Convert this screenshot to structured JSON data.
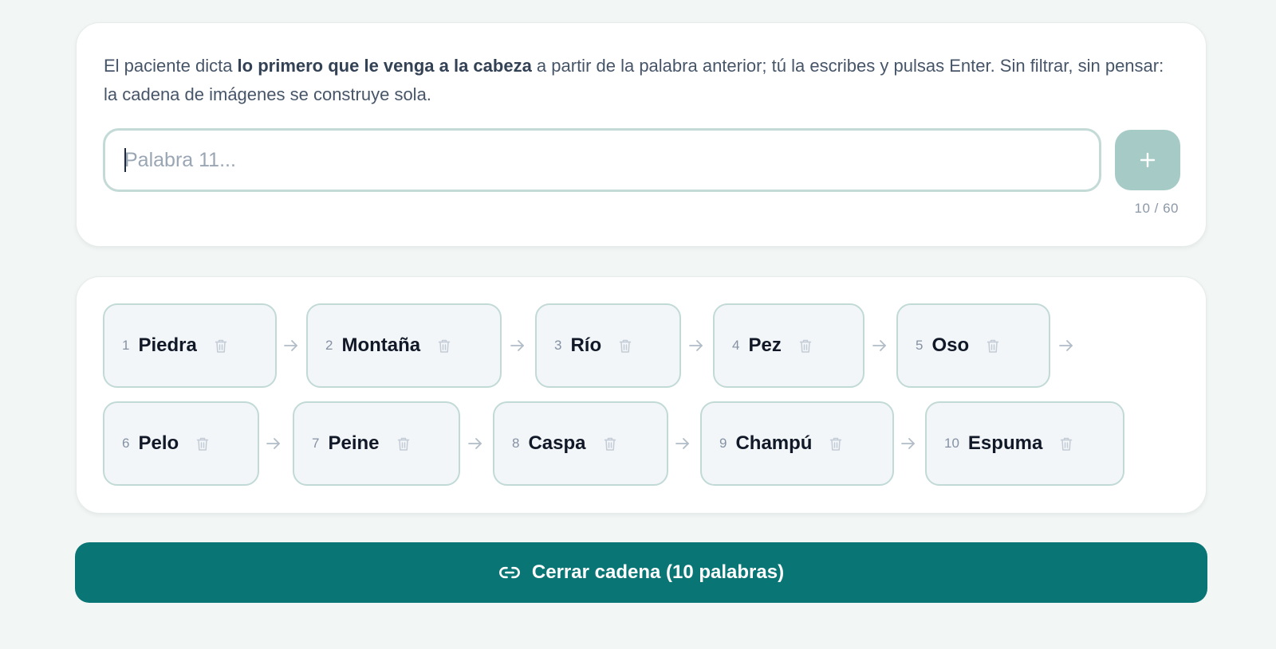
{
  "instructions": {
    "before": "El paciente dicta ",
    "bold": "lo primero que le venga a la cabeza",
    "after": " a partir de la palabra anterior; tú la escribes y pulsas Enter. Sin filtrar, sin pensar: la cadena de imágenes se construye sola."
  },
  "input": {
    "placeholder": "Palabra 11...",
    "value": ""
  },
  "add_button": {
    "icon": "plus-icon"
  },
  "counter": "10 / 60",
  "chain": [
    {
      "num": "1",
      "word": "Piedra"
    },
    {
      "num": "2",
      "word": "Montaña"
    },
    {
      "num": "3",
      "word": "Río"
    },
    {
      "num": "4",
      "word": "Pez"
    },
    {
      "num": "5",
      "word": "Oso"
    },
    {
      "num": "6",
      "word": "Pelo"
    },
    {
      "num": "7",
      "word": "Peine"
    },
    {
      "num": "8",
      "word": "Caspa"
    },
    {
      "num": "9",
      "word": "Champú"
    },
    {
      "num": "10",
      "word": "Espuma"
    }
  ],
  "close_button": {
    "label": "Cerrar cadena (10 palabras)",
    "icon": "link-icon"
  },
  "colors": {
    "accent": "#0a7575",
    "add_button": "#a6cbc7",
    "chip_border": "#c1dad6",
    "chip_bg": "#f3f6f8",
    "background": "#f2f6f5"
  }
}
